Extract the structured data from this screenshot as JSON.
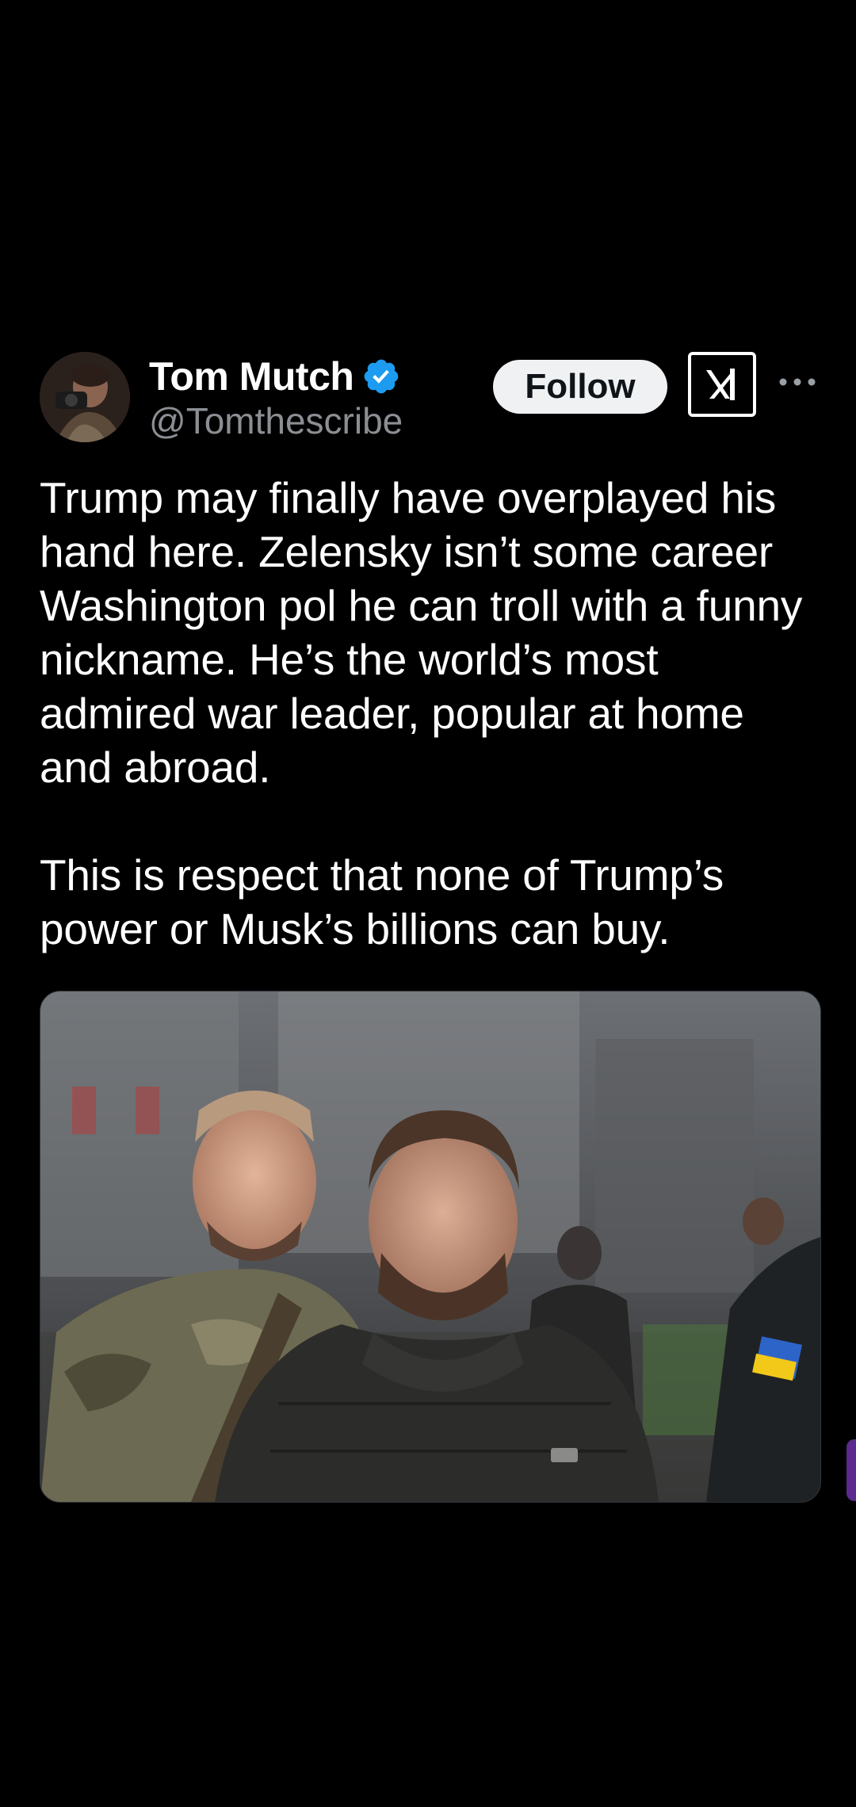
{
  "post": {
    "author": {
      "name": "Tom Mutch",
      "handle": "@Tomthescribe",
      "verified": true
    },
    "follow_label": "Follow",
    "text": "Trump may finally have overplayed his hand here. Zelensky isn’t some career Washington pol he can troll with a funny nickname. He’s the world’s most admired war leader, popular at home and abroad.\n\nThis is respect that none of Trump’s power or Musk’s billions can buy.",
    "icons": {
      "verified": "verified-badge-icon",
      "platform": "x-logo-icon",
      "more": "more-options-icon"
    }
  },
  "colors": {
    "background": "#000000",
    "text": "#ffffff",
    "handle": "#8b8f94",
    "verified": "#1d9bf0",
    "follow_bg": "#eff1f2",
    "follow_text": "#0f1419"
  }
}
